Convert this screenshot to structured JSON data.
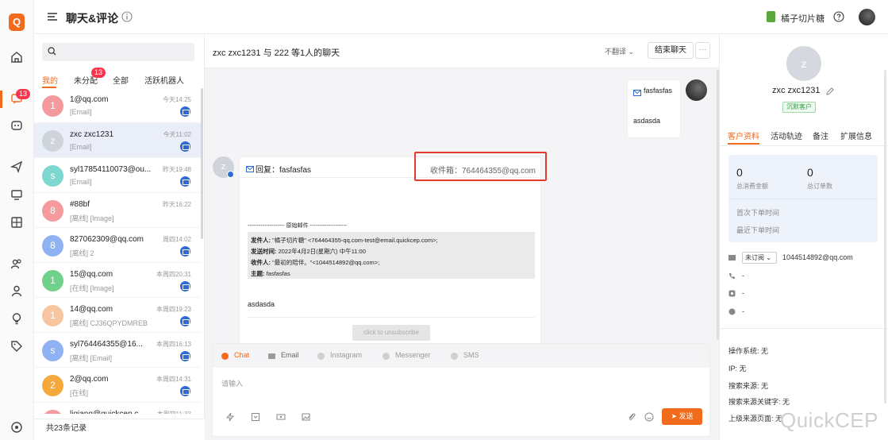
{
  "app": {
    "logo_letter": "Q",
    "rail_badge": "13"
  },
  "topbar": {
    "title": "聊天&评论",
    "shop_name": "橘子切片糖"
  },
  "sidebar": {
    "search_placeholder": "",
    "tabs": [
      {
        "label": "我的"
      },
      {
        "label": "未分配"
      },
      {
        "label": "全部"
      },
      {
        "label": "活跃机器人"
      }
    ],
    "unassigned_badge": "13",
    "conversations": [
      {
        "avatar": "1",
        "color": "#f49a9e",
        "name": "1@qq.com",
        "sub": "[Email]",
        "time": "今天14:25"
      },
      {
        "avatar": "z",
        "color": "#cfd3da",
        "name": "zxc zxc1231",
        "sub": "[Email]",
        "time": "今天11:02"
      },
      {
        "avatar": "s",
        "color": "#7fd7d1",
        "name": "syl17854110073@ou...",
        "sub": "[Email]",
        "time": "昨天19:48"
      },
      {
        "avatar": "8",
        "color": "#f49a9e",
        "name": "#88bf",
        "sub": "[离线] [Image]",
        "time": "昨天16:22"
      },
      {
        "avatar": "8",
        "color": "#8fb3f2",
        "name": "827062309@qq.com",
        "sub": "[离线] 2",
        "time": "周四14:02"
      },
      {
        "avatar": "1",
        "color": "#6fd18a",
        "name": "15@qq.com",
        "sub": "[在线] [Image]",
        "time": "本周四20:31"
      },
      {
        "avatar": "1",
        "color": "#f7c6a0",
        "name": "14@qq.com",
        "sub": "[离线] CJ36QPYDMREB",
        "time": "本周四19:23"
      },
      {
        "avatar": "s",
        "color": "#8fb3f2",
        "name": "syl764464355@16...",
        "sub": "[离线] [Email]",
        "time": "本周四16:13"
      },
      {
        "avatar": "2",
        "color": "#f5a93c",
        "name": "2@qq.com",
        "sub": "[在线]",
        "time": "本周四14:31"
      },
      {
        "avatar": "l",
        "color": "#f49a9e",
        "name": "liqiang@quickcep.c...",
        "sub": "",
        "time": "本周四11:33"
      }
    ],
    "total": "共23条记录"
  },
  "chat": {
    "title": "zxc zxc1231 与 222 等1人的聊天",
    "translate": "不翻译",
    "end_button": "结束聊天",
    "more_button": "···",
    "outgoing": {
      "subject": "fasfasfas",
      "body": "asdasda"
    },
    "incoming": {
      "avatar": "z",
      "subject": "回复：fasfasfas",
      "inbox": "收件箱：764464355@qq.com",
      "original_header": "-------------------- 原始邮件 --------------------",
      "quote": [
        {
          "k": "发件人:",
          "v": " \"橘子切片糖\" <764464355-qq.com-test@email.quickcep.com>;"
        },
        {
          "k": "发送时间:",
          "v": " 2022年4月2日(星期六) 中午11:00"
        },
        {
          "k": "收件人:",
          "v": " \"最初的陪伴。\"<1044514892@qq.com>;"
        },
        {
          "k": "主题:",
          "v": " fasfasfas"
        }
      ],
      "body": "asdasda",
      "unsubscribe": "click to unsubscribe"
    },
    "composer": {
      "tabs": [
        "Chat",
        "Email",
        "Instagram",
        "Messenger",
        "SMS"
      ],
      "placeholder": "请输入",
      "send": "发送"
    }
  },
  "panel": {
    "avatar": "z",
    "name": "zxc zxc1231",
    "tag": "沉默客户",
    "tabs": [
      "客户资料",
      "活动轨迹",
      "备注",
      "扩展信息"
    ],
    "stats": {
      "spend_value": "0",
      "spend_label": "总消费金额",
      "orders_value": "0",
      "orders_label": "总订单数"
    },
    "first_order": "首次下单时间",
    "last_order": "最近下单时间",
    "subscription": "未订阅",
    "email": "1044514892@qq.com",
    "phone": "-",
    "instagram": "-",
    "messenger": "-",
    "meta": [
      "操作系统: 无",
      "IP: 无",
      "搜索来源: 无",
      "搜索来源关键字: 无",
      "上级来源页面: 无"
    ]
  },
  "watermark": "QuickCEP"
}
